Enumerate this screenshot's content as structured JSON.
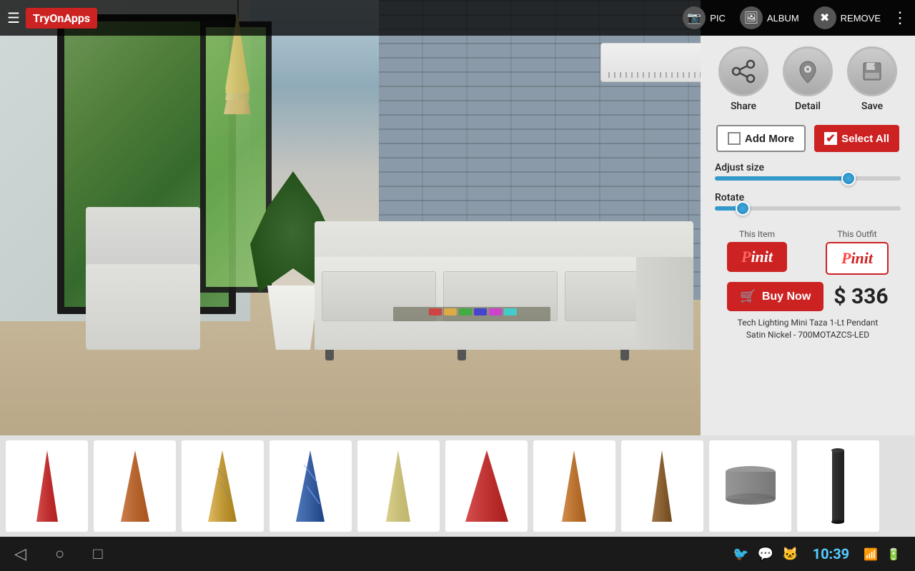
{
  "app": {
    "logo": "TryOnApps",
    "menu_icon": "☰"
  },
  "topbar": {
    "pic_label": "PIC",
    "album_label": "ALBUM",
    "remove_label": "REMOVE"
  },
  "panel": {
    "share_label": "Share",
    "detail_label": "Detail",
    "save_label": "Save",
    "add_more_label": "Add More",
    "select_all_label": "Select All",
    "adjust_size_label": "Adjust size",
    "rotate_label": "Rotate",
    "this_item_label": "This Item",
    "this_outfit_label": "This Outfit",
    "pinit_label": "Pinit",
    "buy_now_label": "Buy Now",
    "price": "$ 336",
    "product_name": "Tech Lighting Mini Taza 1-Lt Pendant\nSatin Nickel - 700MOTAZCS-LED",
    "adjust_fill_pct": 72,
    "rotate_fill_pct": 15
  },
  "thumbnails": [
    {
      "id": 1,
      "color": "#cc2222",
      "shape": "cone_narrow"
    },
    {
      "id": 2,
      "color": "#c86020",
      "shape": "cone_tall"
    },
    {
      "id": 3,
      "color": "#d4a020",
      "shape": "cone_swirl"
    },
    {
      "id": 4,
      "color": "#3060aa",
      "shape": "cone_swirl2"
    },
    {
      "id": 5,
      "color": "#d4c878",
      "shape": "cone_medium"
    },
    {
      "id": 6,
      "color": "#cc2222",
      "shape": "cone_wide"
    },
    {
      "id": 7,
      "color": "#c86020",
      "shape": "cone_tall2"
    },
    {
      "id": 8,
      "color": "#8a6030",
      "shape": "cone_narrow2"
    },
    {
      "id": 9,
      "color": "#888880",
      "shape": "drum"
    },
    {
      "id": 10,
      "color": "#222222",
      "shape": "cylinder"
    }
  ],
  "bottom_nav": {
    "back": "◁",
    "home": "○",
    "recents": "□",
    "time": "10:39"
  }
}
